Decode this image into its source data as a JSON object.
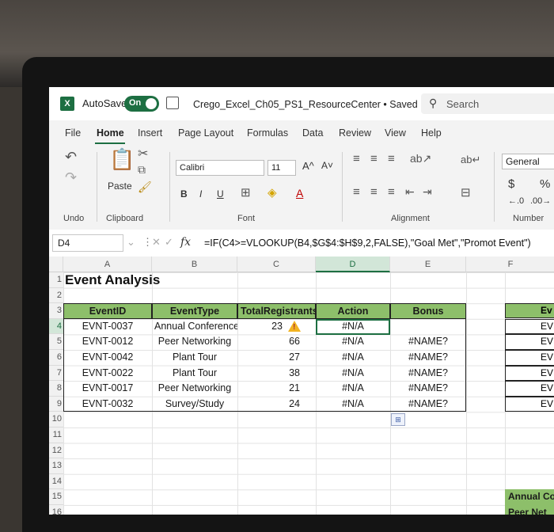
{
  "titlebar": {
    "app_icon": "X",
    "autosave_label": "AutoSave",
    "toggle_label": "On",
    "document_title": "Crego_Excel_Ch05_PS1_ResourceCenter • Saved ⌄",
    "search_placeholder": "Search"
  },
  "menu": {
    "tabs": [
      "File",
      "Home",
      "Insert",
      "Page Layout",
      "Formulas",
      "Data",
      "Review",
      "View",
      "Help"
    ],
    "active": "Home"
  },
  "ribbon": {
    "undo_label": "Undo",
    "clipboard_label": "Clipboard",
    "paste_label": "Paste",
    "font_label": "Font",
    "alignment_label": "Alignment",
    "number_label": "Number",
    "font_name": "Calibri",
    "font_size": "11",
    "number_format": "General",
    "bold": "B",
    "italic": "I",
    "underline": "U",
    "grow": "A^",
    "shrink": "A˅",
    "font_color": "A",
    "currency": "$",
    "percent": "%"
  },
  "formula_bar": {
    "name_box": "D4",
    "fx": "fx",
    "formula": "=IF(C4>=VLOOKUP(B4,$G$4:$H$9,2,FALSE),\"Goal Met\",\"Promot Event\")"
  },
  "columns": [
    "A",
    "B",
    "C",
    "D",
    "E",
    "F"
  ],
  "selected_column": "D",
  "rows": [
    "1",
    "2",
    "3",
    "4",
    "5",
    "6",
    "7",
    "8",
    "9",
    "10",
    "11",
    "12",
    "13",
    "14",
    "15",
    "16"
  ],
  "selected_row": "4",
  "sheet": {
    "title": "Event Analysis",
    "headers": [
      "EventID",
      "EventType",
      "TotalRegistrants",
      "Action",
      "Bonus"
    ],
    "table": [
      [
        "EVNT-0037",
        "Annual Conference",
        "23",
        "#N/A",
        ""
      ],
      [
        "EVNT-0012",
        "Peer Networking",
        "66",
        "#N/A",
        "#NAME?"
      ],
      [
        "EVNT-0042",
        "Plant Tour",
        "27",
        "#N/A",
        "#NAME?"
      ],
      [
        "EVNT-0022",
        "Plant Tour",
        "38",
        "#N/A",
        "#NAME?"
      ],
      [
        "EVNT-0017",
        "Peer Networking",
        "21",
        "#N/A",
        "#NAME?"
      ],
      [
        "EVNT-0032",
        "Survey/Study",
        "24",
        "#N/A",
        "#NAME?"
      ]
    ],
    "side_header": "Ev",
    "side_cells": [
      "EVN",
      "EVN",
      "EVN",
      "EVN",
      "EVN",
      "EVNT"
    ],
    "side_bottom": [
      "Annual Co",
      "Peer Net"
    ]
  },
  "colors": {
    "excel_green": "#1d6f42",
    "header_fill": "#8dbf6a"
  }
}
